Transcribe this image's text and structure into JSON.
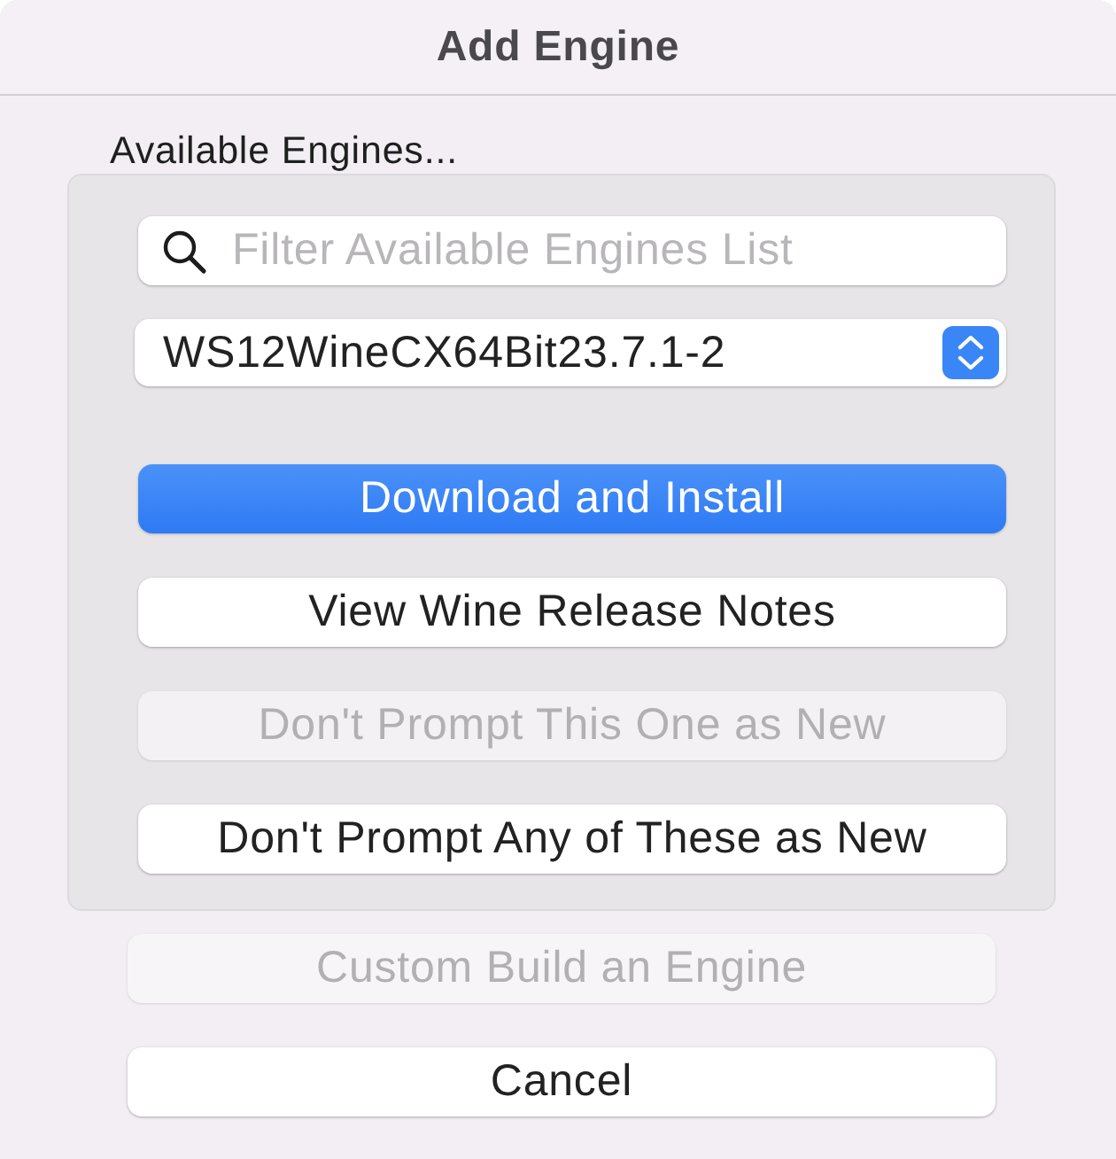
{
  "window": {
    "title": "Add Engine"
  },
  "available": {
    "label": "Available Engines...",
    "search": {
      "placeholder": "Filter Available Engines List"
    },
    "engine_popup": {
      "value": "WS12WineCX64Bit23.7.1-2"
    },
    "buttons": [
      {
        "label": "Download and Install",
        "kind": "primary",
        "disabled": false
      },
      {
        "label": "View Wine Release Notes",
        "kind": "normal",
        "disabled": false
      },
      {
        "label": "Don't Prompt This One as New",
        "kind": "normal",
        "disabled": true
      },
      {
        "label": "Don't Prompt Any of These as New",
        "kind": "normal",
        "disabled": false
      }
    ]
  },
  "footer_buttons": [
    {
      "label": "Custom Build an Engine",
      "kind": "normal",
      "disabled": true
    },
    {
      "label": "Cancel",
      "kind": "normal",
      "disabled": false
    }
  ]
}
